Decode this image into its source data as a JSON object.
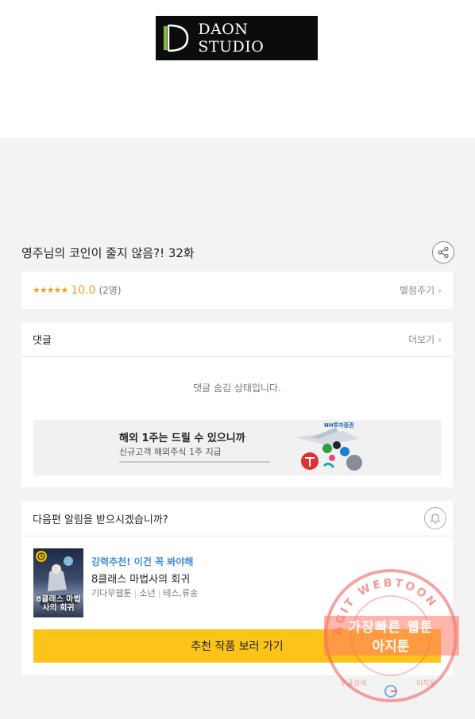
{
  "header": {
    "logo_text": "DAON STUDIO"
  },
  "episode": {
    "title": "영주님의 코인이 줄지 않음?! 32화"
  },
  "rating": {
    "stars": "★★★★★",
    "score": "10.0",
    "count": "(2명)",
    "rate_label": "별점주기"
  },
  "comments": {
    "label": "댓글",
    "more_label": "더보기",
    "hidden_message": "댓글 숨김 상태입니다."
  },
  "ad": {
    "title": "해외 1주는 드릴 수 있으니까",
    "subtitle": "신규고객 해외주식 1주 지급",
    "brand": "NH투자증권"
  },
  "notify": {
    "question": "다음편 알림을 받으시겠습니까?"
  },
  "recommendation": {
    "tag": "강력추천! 이건 꼭 봐야해",
    "title": "8클래스 마법사의 회귀",
    "meta": [
      "기다무웹툰",
      "소년",
      "테스,류송"
    ],
    "thumb_title": "8클래스 마법사의 회귀",
    "button_label": "추천 작품 보러 가기"
  },
  "watermark": {
    "ring_text": "AGIT WEBTOON",
    "line1": "가장빠른 웹툰",
    "line2": "아지툰",
    "bottom_left": "구글검색",
    "bottom_right": "아지툰"
  },
  "colors": {
    "accent_yellow": "#fcc419",
    "star": "#f0a020",
    "link_blue": "#3a8fd8"
  }
}
